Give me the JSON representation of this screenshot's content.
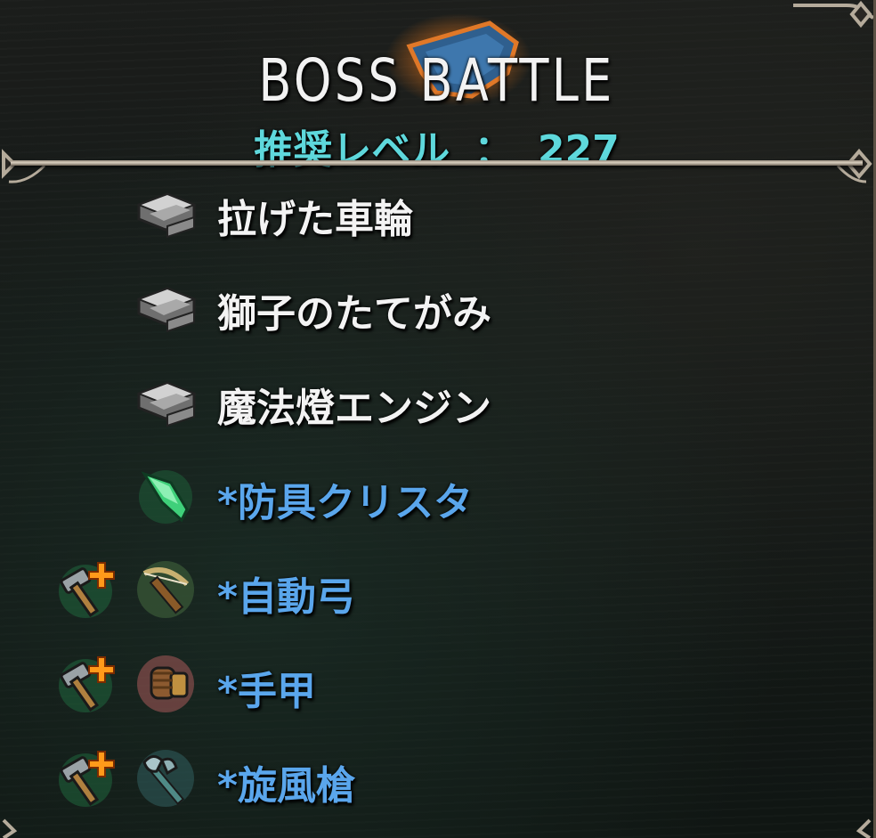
{
  "header": {
    "title": "BOSS BATTLE",
    "level_label": "推奨レベル",
    "level_separator": "：",
    "level_value": "227"
  },
  "colors": {
    "title": "#f2f2f2",
    "level": "#5ed8dc",
    "material_text": "#f3f3f3",
    "equipment_text": "#5aa6ec"
  },
  "rewards": [
    {
      "name": "拉げた車輪",
      "icon": "metal-ingot-icon",
      "modifier_icon": "",
      "color": "white"
    },
    {
      "name": "獅子のたてがみ",
      "icon": "metal-ingot-icon",
      "modifier_icon": "",
      "color": "white"
    },
    {
      "name": "魔法燈エンジン",
      "icon": "metal-ingot-icon",
      "modifier_icon": "",
      "color": "white"
    },
    {
      "name": "*防具クリスタ",
      "icon": "green-crystal-icon",
      "modifier_icon": "",
      "color": "blue"
    },
    {
      "name": "*自動弓",
      "icon": "crossbow-icon",
      "modifier_icon": "hammer-plus-icon",
      "color": "blue"
    },
    {
      "name": "*手甲",
      "icon": "gauntlet-icon",
      "modifier_icon": "hammer-plus-icon",
      "color": "blue"
    },
    {
      "name": "*旋風槍",
      "icon": "halberd-icon",
      "modifier_icon": "hammer-plus-icon",
      "color": "blue"
    }
  ]
}
